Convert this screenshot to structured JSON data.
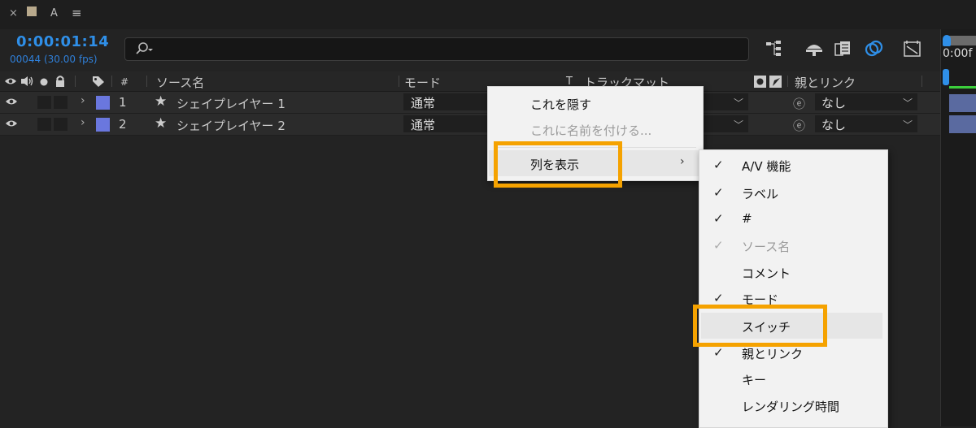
{
  "panel_tabs": {
    "close": "×",
    "comp_letter": "A",
    "menu_glyph": "≡"
  },
  "timecode": "0:00:01:14",
  "frame_info": "00044 (30.00 fps)",
  "search": {
    "placeholder": ""
  },
  "timeline_label": "0:00f",
  "columns": {
    "number": "#",
    "source_name": "ソース名",
    "mode": "モード",
    "trkmat_t": "T",
    "track_matte": "トラックマット",
    "parent_link": "親とリンク"
  },
  "layers": [
    {
      "num": "1",
      "name": "シェイプレイヤー 1",
      "mode": "通常",
      "parent": "なし",
      "label_color": "#6a77de"
    },
    {
      "num": "2",
      "name": "シェイプレイヤー 2",
      "mode": "通常",
      "parent": "なし",
      "label_color": "#6a77de"
    }
  ],
  "context_menu": {
    "items": [
      {
        "label": "これを隠す",
        "disabled": false
      },
      {
        "label": "これに名前を付ける...",
        "disabled": true
      },
      {
        "label": "列を表示",
        "disabled": false,
        "submenu": true
      }
    ]
  },
  "columns_submenu": {
    "items": [
      {
        "label": "A/V 機能",
        "checked": true,
        "disabled": false
      },
      {
        "label": "ラベル",
        "checked": true,
        "disabled": false
      },
      {
        "label": "#",
        "checked": true,
        "disabled": false
      },
      {
        "label": "ソース名",
        "checked": true,
        "disabled": true
      },
      {
        "label": "コメント",
        "checked": false,
        "disabled": false
      },
      {
        "label": "モード",
        "checked": true,
        "disabled": false
      },
      {
        "label": "スイッチ",
        "checked": false,
        "disabled": false
      },
      {
        "label": "親とリンク",
        "checked": true,
        "disabled": false
      },
      {
        "label": "キー",
        "checked": false,
        "disabled": false
      },
      {
        "label": "レンダリング時間",
        "checked": false,
        "disabled": false
      }
    ]
  },
  "checkmark_glyph": "✓",
  "colors": {
    "accent": "#2f8fe8",
    "highlight": "#f5a200",
    "label": "#6a77de"
  }
}
